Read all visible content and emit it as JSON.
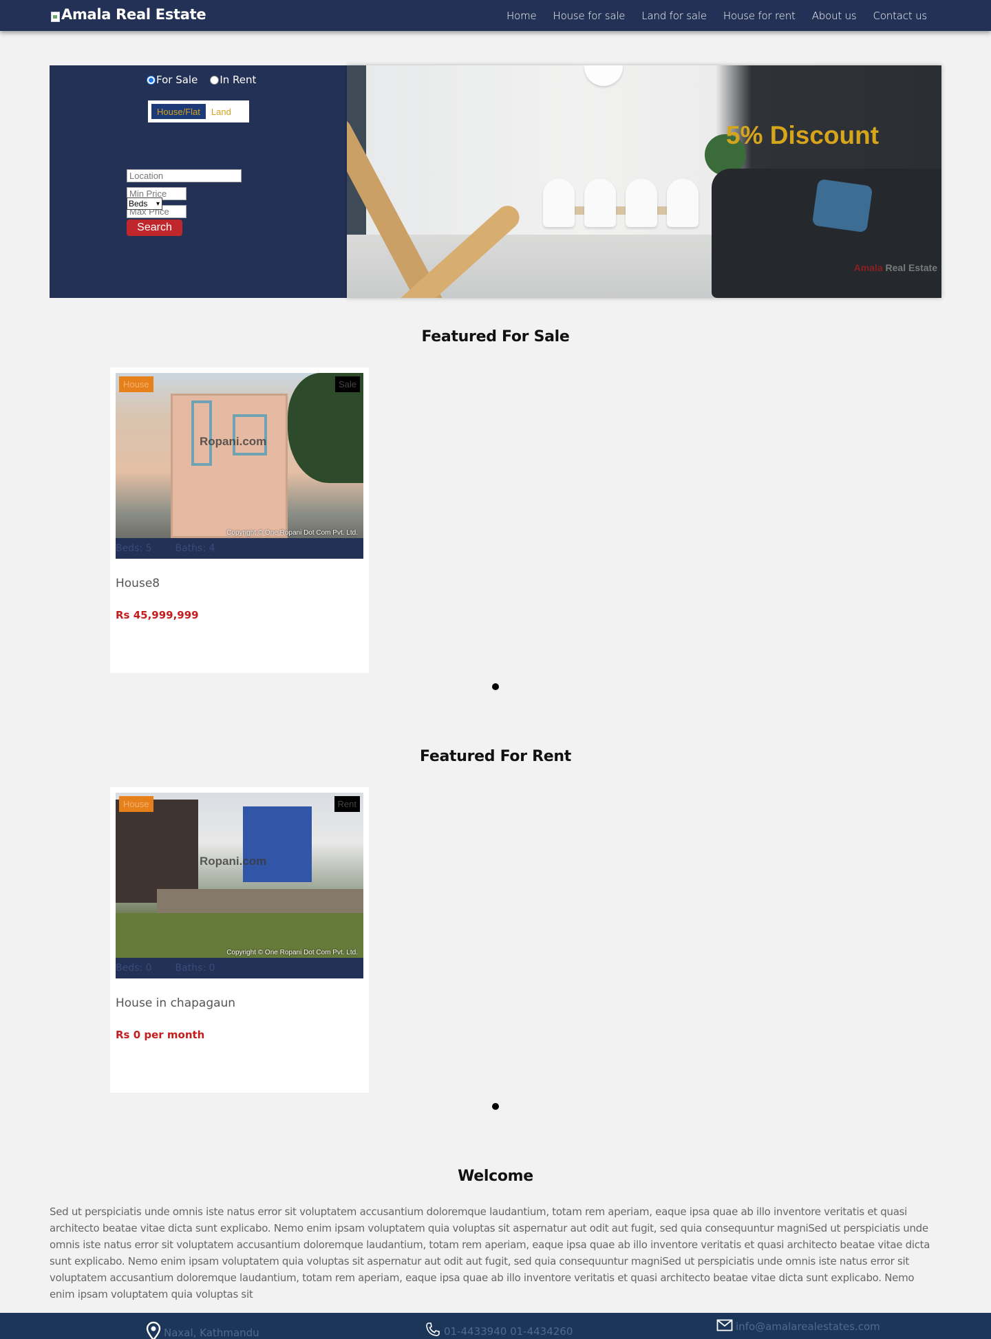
{
  "navbar": {
    "brand": "Amala Real Estate",
    "links": [
      "Home",
      "House for sale",
      "Land for sale",
      "House for rent",
      "About us",
      "Contact us"
    ]
  },
  "search": {
    "radio_sale": "For Sale",
    "radio_rent": "In Rent",
    "tab_house": "House/Flat",
    "tab_land": "Land",
    "location_placeholder": "Location",
    "min_price_placeholder": "Min Price",
    "max_price_placeholder": "Max Price",
    "beds_selected": "Beds",
    "search_button": "Search"
  },
  "banner": {
    "discount": "5% Discount",
    "watermark_red": "Amala",
    "watermark_rest": " Real Estate"
  },
  "featured_sale": {
    "title": "Featured For Sale",
    "cards": [
      {
        "type_badge": "House",
        "status_badge": "Sale",
        "beds_label": "Beds",
        "beds": ": 5",
        "baths_label": "Baths",
        "baths": ": 4",
        "name": "House8",
        "price": "Rs 45,999,999",
        "photo_logo": "Ropani.com",
        "photo_copyright": "Copyright © One Ropani Dot Com Pvt. Ltd."
      }
    ]
  },
  "featured_rent": {
    "title": "Featured For Rent",
    "cards": [
      {
        "type_badge": "House",
        "status_badge": "Rent",
        "beds_label": "Beds",
        "beds": ": 0",
        "baths_label": "Baths",
        "baths": ": 0",
        "name": "House in chapagaun",
        "price": "Rs 0 per month",
        "photo_logo": "Ropani.com",
        "photo_copyright": "Copyright © One Ropani Dot Com Pvt. Ltd."
      }
    ]
  },
  "welcome": {
    "title": "Welcome",
    "text": "Sed ut perspiciatis unde omnis iste natus error sit voluptatem accusantium doloremque laudantium, totam rem aperiam, eaque ipsa quae ab illo inventore veritatis et quasi architecto beatae vitae dicta sunt explicabo. Nemo enim ipsam voluptatem quia voluptas sit aspernatur aut odit aut fugit, sed quia consequuntur magniSed ut perspiciatis unde omnis iste natus error sit voluptatem accusantium doloremque laudantium, totam rem aperiam, eaque ipsa quae ab illo inventore veritatis et quasi architecto beatae vitae dicta sunt explicabo. Nemo enim ipsam voluptatem quia voluptas sit aspernatur aut odit aut fugit, sed quia consequuntur magniSed ut perspiciatis unde omnis iste natus error sit voluptatem accusantium doloremque laudantium, totam rem aperiam, eaque ipsa quae ab illo inventore veritatis et quasi architecto beatae vitae dicta sunt explicabo. Nemo enim ipsam voluptatem quia voluptas sit"
  },
  "footer": {
    "address": "Naxal, Kathmandu",
    "phone": "01-4433940 01-4434260",
    "email": "info@amalarealestates.com"
  },
  "colors": {
    "navy": "#223155",
    "price_red": "#c41d1d",
    "discount_gold": "#d6a51b",
    "badge_orange": "#e5801b",
    "button_red": "#c0272d"
  },
  "icons": [
    "map-pin-icon",
    "phone-icon",
    "envelope-icon"
  ]
}
